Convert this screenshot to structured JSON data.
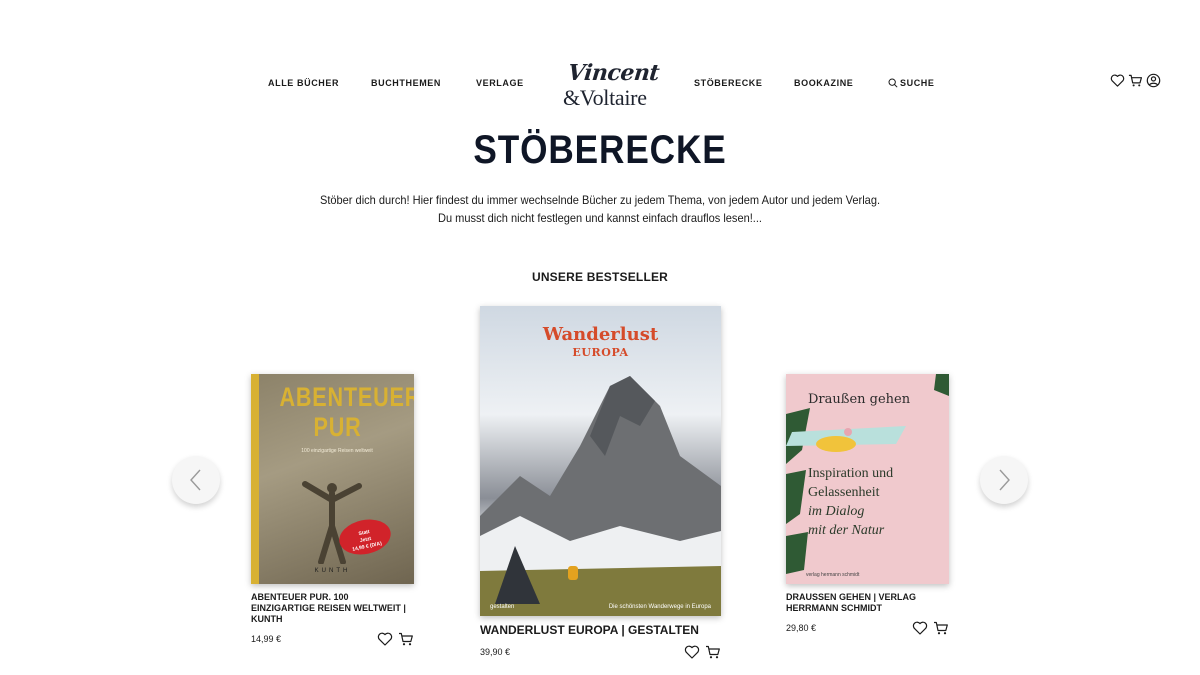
{
  "nav": {
    "links": [
      "ALLE BÜCHER",
      "BUCHTHEMEN",
      "VERLAGE",
      "STÖBERECKE",
      "BOOKAZINE",
      "SUCHE"
    ],
    "logo": {
      "line1": "Vincent",
      "line2": "&Voltaire"
    },
    "icons": [
      "heart-icon",
      "cart-icon",
      "user-icon"
    ]
  },
  "page": {
    "title": "STÖBERECKE",
    "intro_line1": "Stöber dich durch! Hier findest du immer wechselnde Bücher zu jedem Thema, von jedem Autor und jedem Verlag.",
    "intro_line2": "Du musst dich nicht festlegen und kannst einfach drauflos lesen!...",
    "section_label": "UNSERE BESTSELLER"
  },
  "books": [
    {
      "title": "ABENTEUER PUR. 100 EINZIGARTIGE REISEN WELTWEIT | KUNTH",
      "price": "14,99 €",
      "cover_title": "ABENTEUER PUR",
      "cover_subtitle": "100 einzigartige Reisen weltweit",
      "cover_badge_line1": "Statt",
      "cover_badge_line2": "Jetzt",
      "cover_badge_price": "14,99 € (D/A)",
      "cover_brand": "KUNTH"
    },
    {
      "title": "WANDERLUST EUROPA | GESTALTEN",
      "price": "39,90 €",
      "cover_title": "Wanderlust",
      "cover_subtitle": "EUROPA",
      "cover_publisher": "gestalten",
      "cover_tagline": "Die schönsten Wanderwege in Europa"
    },
    {
      "title": "DRAUSSEN GEHEN | VERLAG HERRMANN SCHMIDT",
      "price": "29,80 €",
      "cover_title": "Draußen gehen",
      "cover_line1": "Inspiration und",
      "cover_line2": "Gelassenheit",
      "cover_line3": "im Dialog",
      "cover_line4": "mit der Natur",
      "cover_publisher": "verlag hermann schmidt"
    }
  ],
  "colors": {
    "accent": "#0f1626",
    "kunth_yellow": "#d8b133",
    "wanderlust_red": "#d54b2a",
    "badge_red": "#d1232a"
  }
}
